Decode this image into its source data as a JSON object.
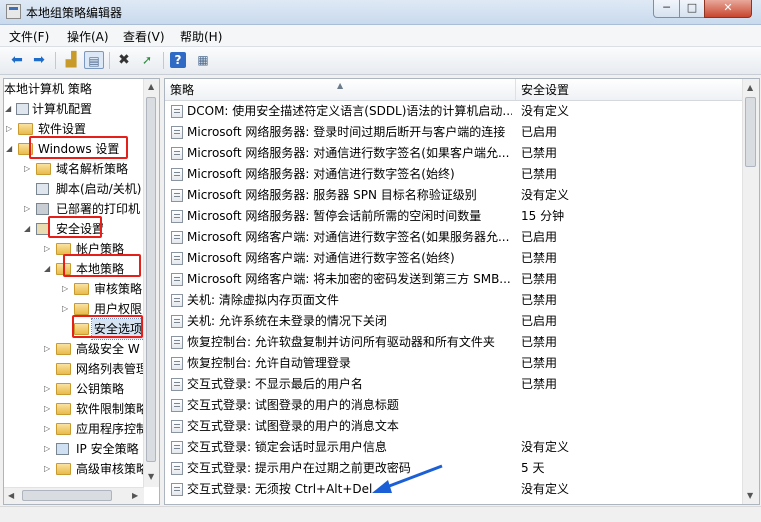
{
  "window": {
    "title": "本地组策略编辑器",
    "min_glyph": "─",
    "max_glyph": "□",
    "close_glyph": "✕"
  },
  "menu": {
    "items": [
      "文件(F)",
      "操作(A)",
      "查看(V)",
      "帮助(H)"
    ]
  },
  "toolbar": {
    "icons": [
      "back-arrow-icon",
      "forward-arrow-icon",
      "up-folder-icon",
      "show-hide-tree-icon",
      "delete-icon",
      "export-list-icon",
      "help-icon",
      "properties-icon"
    ]
  },
  "tree": {
    "items": [
      {
        "label": "本地计算机 策略"
      },
      {
        "label": "计算机配置"
      },
      {
        "label": "软件设置"
      },
      {
        "label": "Windows 设置"
      },
      {
        "label": "域名解析策略"
      },
      {
        "label": "脚本(启动/关机)"
      },
      {
        "label": "已部署的打印机"
      },
      {
        "label": "安全设置"
      },
      {
        "label": "帐户策略"
      },
      {
        "label": "本地策略"
      },
      {
        "label": "审核策略"
      },
      {
        "label": "用户权限"
      },
      {
        "label": "安全选项"
      },
      {
        "label": "高级安全 W"
      },
      {
        "label": "网络列表管理"
      },
      {
        "label": "公钥策略"
      },
      {
        "label": "软件限制策略"
      },
      {
        "label": "应用程序控制"
      },
      {
        "label": "IP 安全策略"
      },
      {
        "label": "高级审核策略"
      }
    ]
  },
  "list": {
    "columns": [
      "策略",
      "安全设置"
    ],
    "rows": [
      {
        "policy": "DCOM: 使用安全描述符定义语言(SDDL)语法的计算机启动...",
        "setting": "没有定义"
      },
      {
        "policy": "Microsoft 网络服务器: 登录时间过期后断开与客户端的连接",
        "setting": "已启用"
      },
      {
        "policy": "Microsoft 网络服务器: 对通信进行数字签名(如果客户端允...",
        "setting": "已禁用"
      },
      {
        "policy": "Microsoft 网络服务器: 对通信进行数字签名(始终)",
        "setting": "已禁用"
      },
      {
        "policy": "Microsoft 网络服务器: 服务器 SPN 目标名称验证级别",
        "setting": "没有定义"
      },
      {
        "policy": "Microsoft 网络服务器: 暂停会话前所需的空闲时间数量",
        "setting": "15 分钟"
      },
      {
        "policy": "Microsoft 网络客户端: 对通信进行数字签名(如果服务器允...",
        "setting": "已启用"
      },
      {
        "policy": "Microsoft 网络客户端: 对通信进行数字签名(始终)",
        "setting": "已禁用"
      },
      {
        "policy": "Microsoft 网络客户端: 将未加密的密码发送到第三方 SMB...",
        "setting": "已禁用"
      },
      {
        "policy": "关机: 清除虚拟内存页面文件",
        "setting": "已禁用"
      },
      {
        "policy": "关机: 允许系统在未登录的情况下关闭",
        "setting": "已启用"
      },
      {
        "policy": "恢复控制台: 允许软盘复制并访问所有驱动器和所有文件夹",
        "setting": "已禁用"
      },
      {
        "policy": "恢复控制台: 允许自动管理登录",
        "setting": "已禁用"
      },
      {
        "policy": "交互式登录: 不显示最后的用户名",
        "setting": "已禁用"
      },
      {
        "policy": "交互式登录: 试图登录的用户的消息标题",
        "setting": ""
      },
      {
        "policy": "交互式登录: 试图登录的用户的消息文本",
        "setting": ""
      },
      {
        "policy": "交互式登录: 锁定会话时显示用户信息",
        "setting": "没有定义"
      },
      {
        "policy": "交互式登录: 提示用户在过期之前更改密码",
        "setting": "5 天"
      },
      {
        "policy": "交互式登录: 无须按 Ctrl+Alt+Del",
        "setting": "没有定义"
      }
    ]
  },
  "colors": {
    "highlight_box": "#e5201b",
    "arrow": "#1b5fd6"
  }
}
